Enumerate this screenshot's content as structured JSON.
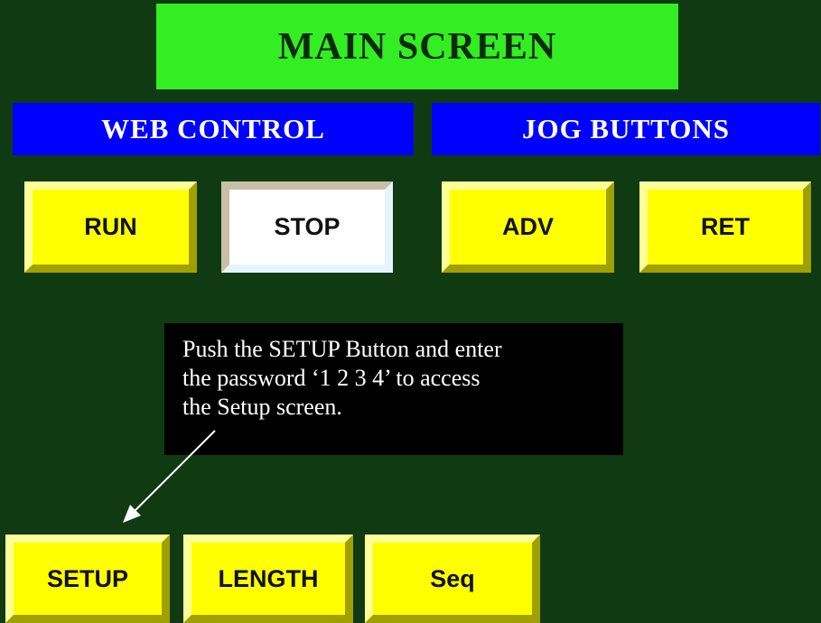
{
  "title": "MAIN SCREEN",
  "sections": {
    "web_control": "WEB CONTROL",
    "jog_buttons": "JOG BUTTONS"
  },
  "buttons": {
    "run": "RUN",
    "stop": "STOP",
    "adv": "ADV",
    "ret": "RET",
    "setup": "SETUP",
    "length": "LENGTH",
    "seq": "Seq"
  },
  "callout": {
    "text": "Push the SETUP Button and enter\nthe password ‘1 2 3 4’ to access\nthe Setup screen."
  },
  "colors": {
    "background": "#0f3a12",
    "title_bar": "#33ee22",
    "section_bar": "#0000ff",
    "button_active": "#ffff00",
    "button_stop": "#ffffff",
    "callout_bg": "#000000"
  }
}
